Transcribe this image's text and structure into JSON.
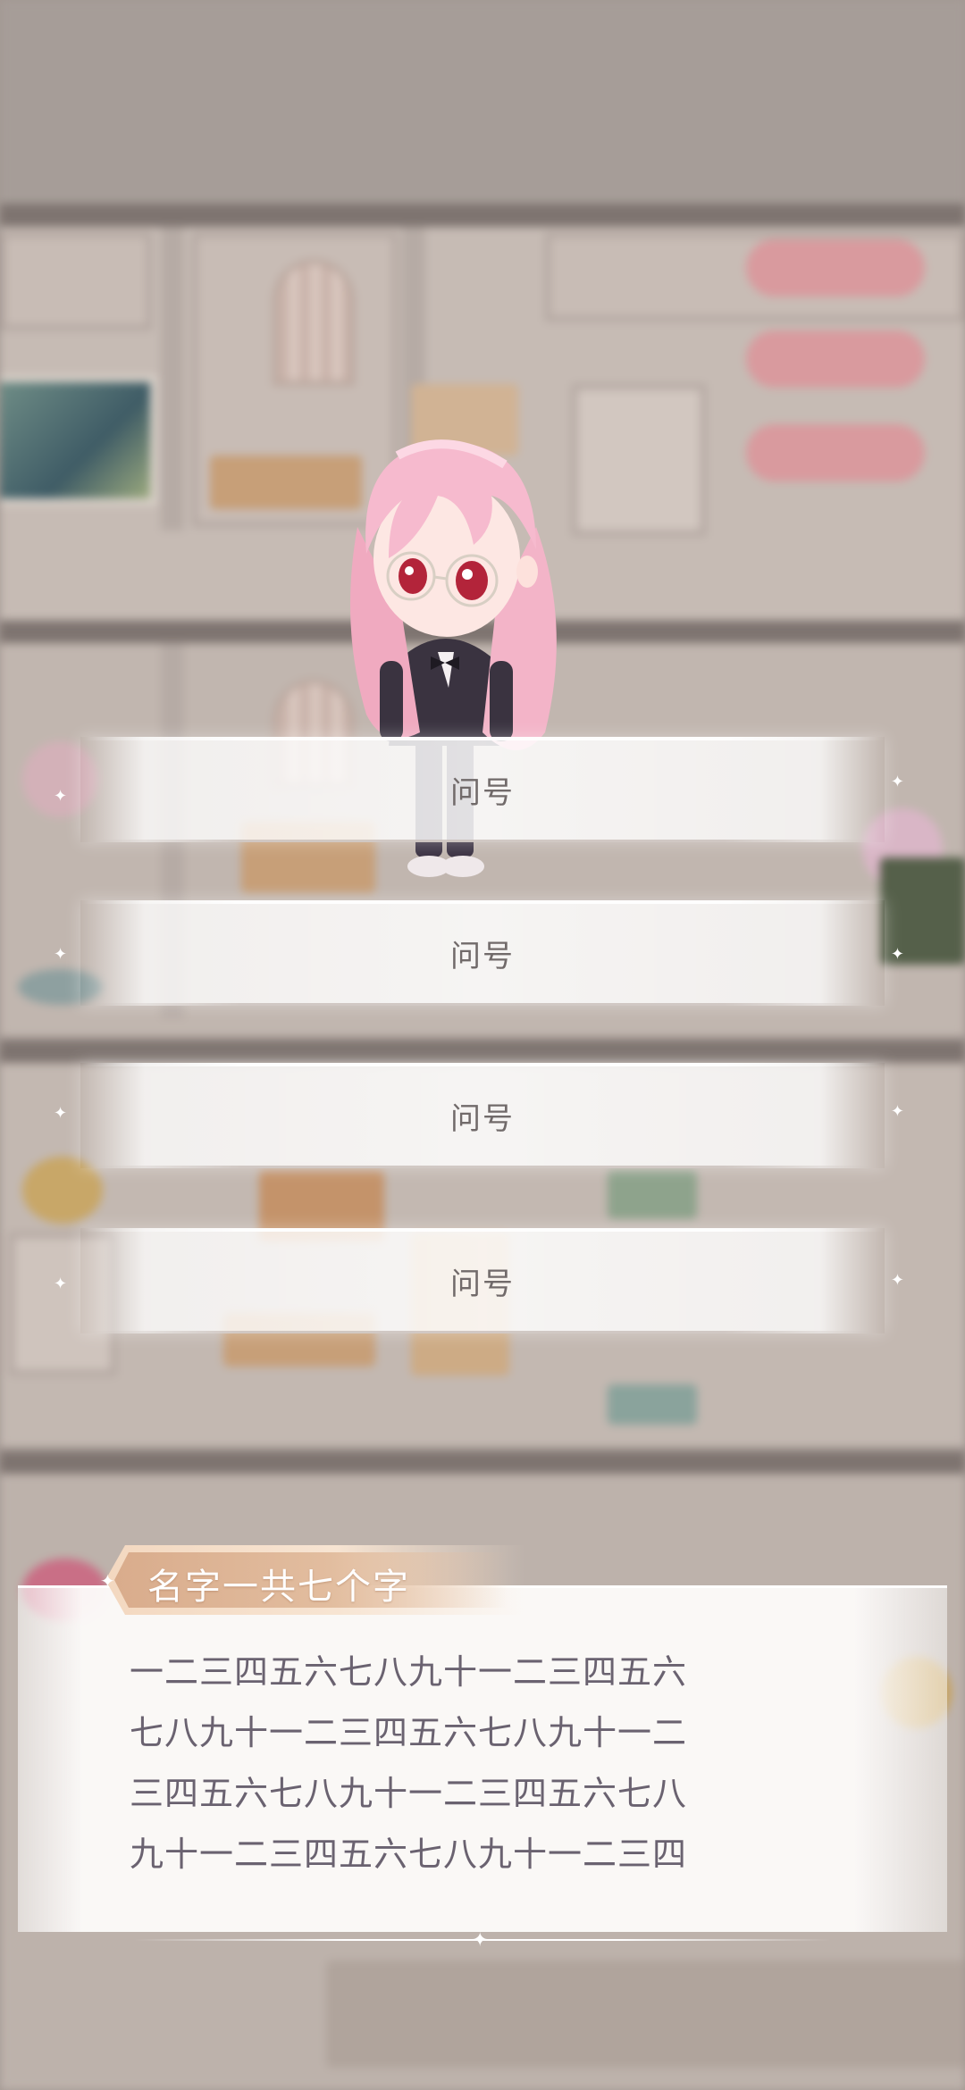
{
  "options": [
    {
      "label": "问号"
    },
    {
      "label": "问号"
    },
    {
      "label": "问号"
    },
    {
      "label": "问号"
    }
  ],
  "dialog": {
    "speaker": "名字一共七个字",
    "lines": [
      "一二三四五六七八九十一二三四五六",
      "七八九十一二三四五六七八九十一二",
      "三四五六七八九十一二三四五六七八",
      "九十一二三四五六七八九十一二三四"
    ]
  },
  "colors": {
    "option_text": "#716a6a",
    "dialog_text": "#6a6270",
    "nameplate": "#d9ac8c",
    "hair": "#f4b7c8"
  },
  "icons": [
    "sparkle-icon",
    "star-icon"
  ]
}
